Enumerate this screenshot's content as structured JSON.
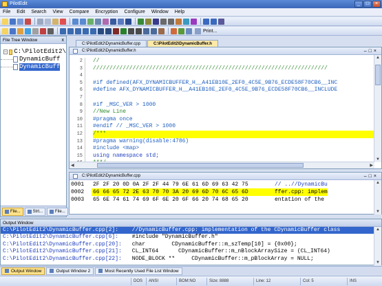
{
  "window": {
    "title": "PilotEdit"
  },
  "menu": [
    "File",
    "Edit",
    "Search",
    "View",
    "Compare",
    "Encryption",
    "Configure",
    "Window",
    "Help"
  ],
  "toolbar": {
    "print_label": "Print..."
  },
  "file_tree": {
    "title": "File Tree Window",
    "close_label": "x",
    "items": [
      {
        "label": "C:\\PilotEdit2\\"
      },
      {
        "label": "DynamicBuff"
      },
      {
        "label": "DynamicBuff"
      }
    ],
    "tabs": [
      "File...",
      "Strt...",
      "File..."
    ]
  },
  "tabs": [
    {
      "label": "C:\\PilotEdit2\\DynamicBuffer.cpp"
    },
    {
      "label": "C:\\PilotEdit2\\DynamicBuffer.h"
    }
  ],
  "editor": {
    "path": "C:\\PilotEdit2\\DynamicBuffer.h",
    "line_numbers": [
      "2",
      "3",
      "4",
      "5",
      "6",
      "7",
      "8",
      "9",
      "10",
      "11",
      "12",
      "13",
      "14",
      "15",
      "16"
    ],
    "lines": [
      "//",
      "///////////////////////////////////////////////////////////////////////",
      "",
      "#if defined(AFX_DYNAMICBUFFER_H__A41EB10E_2EF0_4C5E_9B76_ECDE58F70CB6__INC",
      "#define AFX_DYNAMICBUFFER_H__A41EB10E_2EF0_4C5E_9B76_ECDE58F70CB6__INCLUDE",
      "",
      "#if _MSC_VER > 1000",
      "//New Line",
      "#pragma once",
      "#endif // _MSC_VER > 1000",
      "/***",
      "#pragma warning(disable:4786)",
      "#include <map>",
      "using namespace std;",
      "***/"
    ]
  },
  "hex": {
    "path": "C:\\PilotEdit2\\DynamicBuffer.cpp",
    "rows": [
      {
        "offset": "0001",
        "bytes": "2F 2F 20 0D 0A 2F 2F 44 79 6E 61 6D 69 63 42 75",
        "ascii": "// ..//DynamicBu"
      },
      {
        "offset": "0002",
        "bytes": "66 66 65 72 2E 63 70 70 3A 20 69 6D 70 6C 65 6D",
        "ascii": "ffer.cpp: implem"
      },
      {
        "offset": "0003",
        "bytes": "65 6E 74 61 74 69 6F 6E 20 6F 66 20 74 68 65 20",
        "ascii": "entation of the "
      }
    ]
  },
  "output": {
    "title": "Output Window",
    "rows": [
      {
        "path": "C:\\PilotEdit2\\DynamicBuffer.cpp[2]:",
        "text": " //DynamicBuffer.cpp: implementation of the CDynamicBuffer class"
      },
      {
        "path": "C:\\PilotEdit2\\DynamicBuffer.cpp[6]:",
        "text": " #include \"DynamicBuffer.h\""
      },
      {
        "path": "C:\\PilotEdit2\\DynamicBuffer.cpp[20]:",
        "text": " char        CDynamicBuffer::m_szTemp[10] = {0x00};"
      },
      {
        "path": "C:\\PilotEdit2\\DynamicBuffer.cpp[21]:",
        "text": " CL_INT64      CDynamicBuffer::m_nBlockArraySize = (CL_INT64)"
      },
      {
        "path": "C:\\PilotEdit2\\DynamicBuffer.cpp[22]:",
        "text": " NODE_BLOCK **     CDynamicBuffer::m_pBlockArray = NULL;"
      }
    ]
  },
  "bottom_tabs": [
    "Output Window",
    "Output Window 2",
    "Most Recently Used File List Window"
  ],
  "status": [
    "DOS",
    "ANSI",
    "BOM:NO",
    "Size: 8888",
    "Line: 12",
    "Col: 5",
    "INS"
  ],
  "colors": {
    "highlight": "#ffff00",
    "selection": "#3366cc",
    "comment": "#2e8b2e",
    "preproc": "#1f5fbf"
  }
}
